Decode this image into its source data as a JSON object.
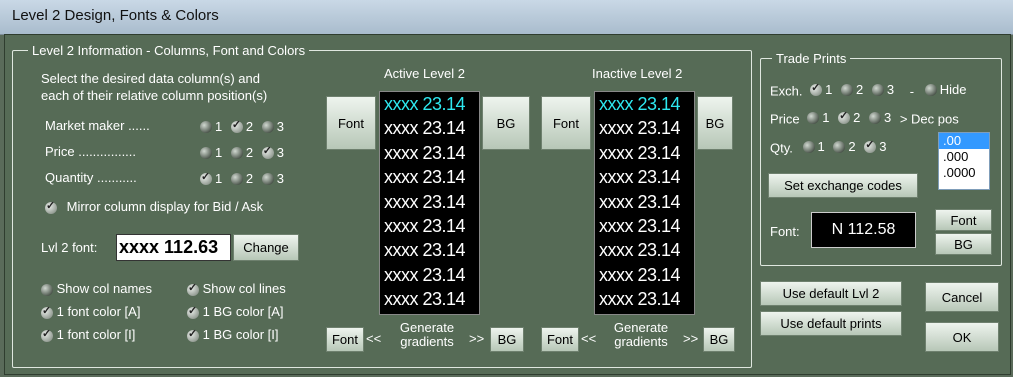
{
  "window": {
    "title": "Level 2 Design, Fonts & Colors"
  },
  "level2": {
    "group_title": "Level 2 Information - Columns, Font and Colors",
    "instructions": [
      "Select the desired data column(s) and",
      "each of their relative column position(s)"
    ],
    "columns": [
      {
        "label": "Market maker ......",
        "options": [
          "1",
          "2",
          "3"
        ],
        "selected": "2"
      },
      {
        "label": "Price ................",
        "options": [
          "1",
          "2",
          "3"
        ],
        "selected": "3"
      },
      {
        "label": "Quantity ...........",
        "options": [
          "1",
          "2",
          "3"
        ],
        "selected": "1"
      }
    ],
    "mirror_label": "Mirror column display for Bid / Ask",
    "font_label": "Lvl 2 font:",
    "font_preview": "xxxx  112.63",
    "change_label": "Change",
    "checks": [
      {
        "label": "Show col names",
        "checked": false
      },
      {
        "label": "Show col lines",
        "checked": true
      },
      {
        "label": "1 font color [A]",
        "checked": true
      },
      {
        "label": "1 BG color [A]",
        "checked": true
      },
      {
        "label": "1 font color [I]",
        "checked": true
      },
      {
        "label": "1 BG color [I]",
        "checked": true
      }
    ]
  },
  "active": {
    "title": "Active Level 2",
    "font_btn": "Font",
    "bg_btn": "BG",
    "rows": [
      "xxxx 23.14",
      "xxxx 23.14",
      "xxxx 23.14",
      "xxxx 23.14",
      "xxxx 23.14",
      "xxxx 23.14",
      "xxxx 23.14",
      "xxxx 23.14",
      "xxxx 23.14"
    ],
    "first_row_color": "#2ee8f0"
  },
  "inactive": {
    "title": "Inactive Level 2",
    "font_btn": "Font",
    "bg_btn": "BG",
    "rows": [
      "xxxx 23.14",
      "xxxx 23.14",
      "xxxx 23.14",
      "xxxx 23.14",
      "xxxx 23.14",
      "xxxx 23.14",
      "xxxx 23.14",
      "xxxx 23.14",
      "xxxx 23.14"
    ]
  },
  "gradients": {
    "font_btn": "Font",
    "bg_btn": "BG",
    "left_arrows": "<<",
    "right_arrows": ">>",
    "label_line1": "Generate",
    "label_line2": "gradients"
  },
  "trade_prints": {
    "group_title": "Trade Prints",
    "exch_label": "Exch.",
    "exch_options": [
      "1",
      "2",
      "3"
    ],
    "exch_selected": "1",
    "dash": "-",
    "hide_label": "Hide",
    "price_label": "Price",
    "price_options": [
      "1",
      "2",
      "3"
    ],
    "price_selected": "2",
    "dec_pos_label": "> Dec pos",
    "qty_label": "Qty.",
    "qty_options": [
      "1",
      "2",
      "3"
    ],
    "qty_selected": "3",
    "dec_options": [
      ".00",
      ".000",
      ".0000"
    ],
    "dec_selected": ".00",
    "set_exchange_label": "Set exchange codes",
    "font_label": "Font:",
    "font_preview": "N  112.58",
    "font_btn": "Font",
    "bg_btn": "BG"
  },
  "actions": {
    "default_lvl2": "Use default Lvl 2",
    "default_prints": "Use default prints",
    "cancel": "Cancel",
    "ok": "OK"
  }
}
